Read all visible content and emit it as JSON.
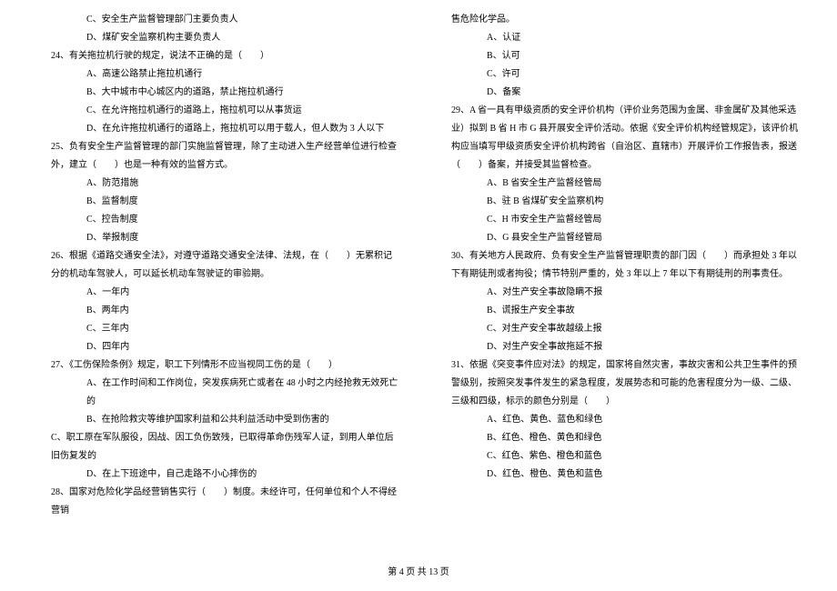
{
  "left_column": {
    "opts_prev": [
      "C、安全生产监督管理部门主要负责人",
      "D、煤矿安全监察机构主要负责人"
    ],
    "q24": {
      "text": "24、有关拖拉机行驶的规定，说法不正确的是（　　）",
      "opts": [
        "A、高速公路禁止拖拉机通行",
        "B、大中城市中心城区内的道路，禁止拖拉机通行",
        "C、在允许拖拉机通行的道路上，拖拉机可以从事货运",
        "D、在允许拖拉机通行的道路上，拖拉机可以用于载人，但人数为 3 人以下"
      ]
    },
    "q25": {
      "text": "25、负有安全生产监督管理的部门实施监督管理，除了主动进入生产经营单位进行检查外，建立（　　）也是一种有效的监督方式。",
      "opts": [
        "A、防范措施",
        "B、监督制度",
        "C、控告制度",
        "D、举报制度"
      ]
    },
    "q26": {
      "text": "26、根据《道路交通安全法》，对遵守道路交通安全法律、法规，在（　　）无累积记分的机动车驾驶人，可以延长机动车驾驶证的审验期。",
      "opts": [
        "A、一年内",
        "B、两年内",
        "C、三年内",
        "D、四年内"
      ]
    },
    "q27": {
      "text": "27、《工伤保险条例》规定，职工下列情形不应当视同工伤的是（　　）",
      "opts": [
        "A、在工作时间和工作岗位，突发疾病死亡或者在 48 小时之内经抢救无效死亡的",
        "B、在抢险救灾等维护国家利益和公共利益活动中受到伤害的",
        "C、职工原在军队服役，因战、因工负伤致残，已取得革命伤残军人证，到用人单位后旧伤复发的",
        "D、在上下班途中，自己走路不小心摔伤的"
      ]
    },
    "q28": {
      "text": "28、国家对危险化学品经营销售实行（　　）制度。未经许可，任何单位和个人不得经营销"
    }
  },
  "right_column": {
    "q28_cont": {
      "text": "售危险化学品。",
      "opts": [
        "A、认证",
        "B、认可",
        "C、许可",
        "D、备案"
      ]
    },
    "q29": {
      "text": "29、A 省一具有甲级资质的安全评价机构（评价业务范围为金属、非金属矿及其他采选业）拟到 B 省 H 市 G 县开展安全评价活动。依据《安全评价机构经管规定》，该评价机构应当填写甲级资质安全评价机构跨省（自治区、直辖市）开展评价工作报告表，报送（　　）备案，并接受其监督检查。",
      "opts": [
        "A、B 省安全生产监督经管局",
        "B、驻 B 省煤矿安全监察机构",
        "C、H 市安全生产监督经管局",
        "D、G 县安全生产监督经管局"
      ]
    },
    "q30": {
      "text": "30、有关地方人民政府、负有安全生产监督管理职责的部门因（　　）而承担处 3 年以下有期徒刑或者拘役；情节特别严重的，处 3 年以上 7 年以下有期徒刑的刑事责任。",
      "opts": [
        "A、对生产安全事故隐瞒不报",
        "B、谎报生产安全事故",
        "C、对生产安全事故越级上报",
        "D、对生产安全事故拖延不报"
      ]
    },
    "q31": {
      "text": "31、依据《突变事件应对法》的规定，国家将自然灾害，事故灾害和公共卫生事件的预警级别，按照突发事件发生的紧急程度，发展势态和可能的危害程度分为一级、二级、三级和四级，标示的颜色分别是（　　）",
      "opts": [
        "A、红色、黄色、蓝色和绿色",
        "B、红色、橙色、黄色和绿色",
        "C、红色、紫色、橙色和蓝色",
        "D、红色、橙色、黄色和蓝色"
      ]
    }
  },
  "footer": "第 4 页 共 13 页"
}
